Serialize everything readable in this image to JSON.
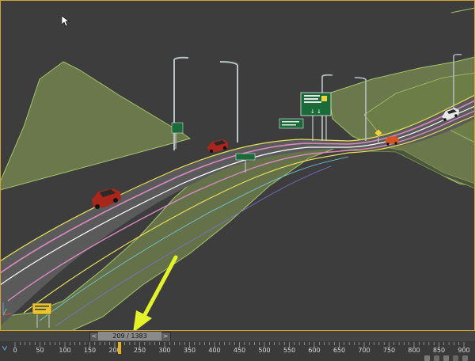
{
  "timeline": {
    "frame_display": "209 / 1383",
    "prev_label": "<",
    "next_label": ">",
    "ruler_labels": [
      "0",
      "50",
      "100",
      "150",
      "200",
      "250",
      "300",
      "350",
      "400",
      "450",
      "500",
      "550",
      "600",
      "650",
      "700",
      "750",
      "800",
      "850",
      "900"
    ],
    "current_frame": 209,
    "total_frames": 1383
  },
  "signs": {
    "overhead_sign_arrows": "↓ ↓"
  },
  "colors": {
    "viewport_bg": "#3d3d3d",
    "terrain": "#73834e",
    "road": "#5a5a5a",
    "active_border": "#d2a232",
    "sign_green": "#1b6b3a",
    "annotation_arrow": "#e4f22a"
  },
  "icons": [
    "mouse-cursor-icon",
    "axis-gizmo-icon",
    "prev-frame-icon",
    "next-frame-icon",
    "playhead-icon",
    "key-icon",
    "lock-icon"
  ]
}
